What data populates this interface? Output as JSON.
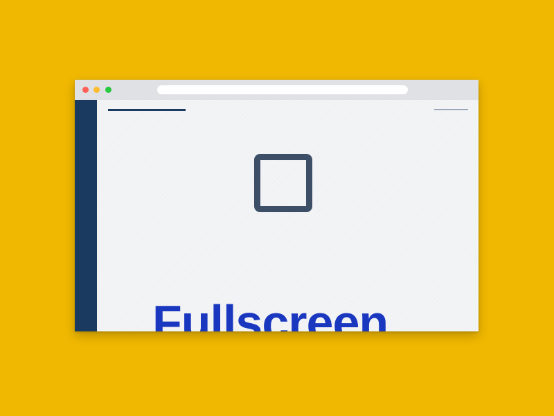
{
  "colors": {
    "background": "#F0B800",
    "window_content": "#F3F4F6",
    "titlebar": "#DFE1E5",
    "sidebar": "#1A3A60",
    "accent_text": "#1A37BF",
    "icon": "#3D4F66",
    "traffic_close": "#FF5F57",
    "traffic_minimize": "#FEBC2E",
    "traffic_maximize": "#28C840"
  },
  "window": {
    "traffic_lights": [
      "close",
      "minimize",
      "maximize"
    ]
  },
  "main": {
    "icon": "square-outline-icon",
    "hero_title": "Fullscreen"
  }
}
